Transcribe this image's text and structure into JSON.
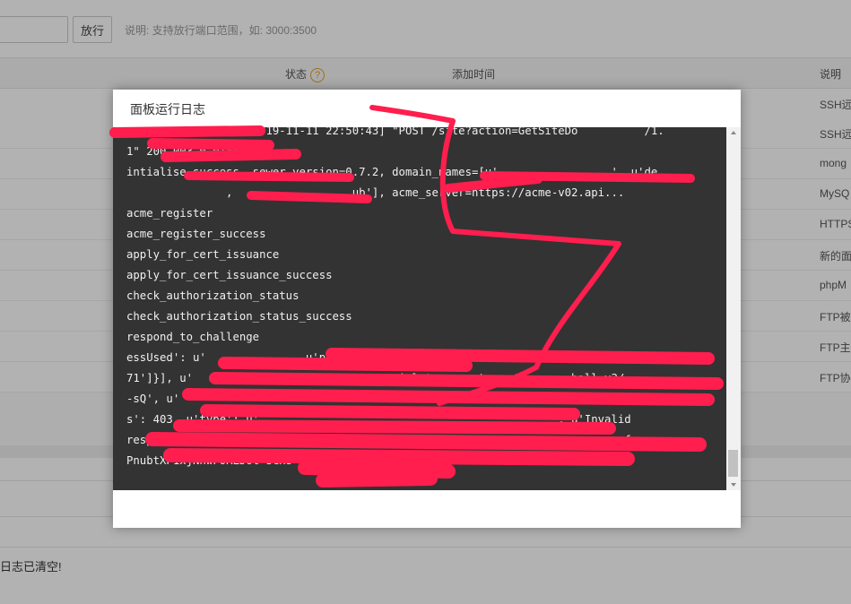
{
  "toolbar": {
    "port_input_value": "",
    "release_button": "放行",
    "hint": "说明: 支持放行端口范围，如: 3000:3500"
  },
  "table": {
    "headers": {
      "status": "状态",
      "status_help": "?",
      "added_time": "添加时间",
      "description": "说明"
    },
    "rows": [
      {
        "description": "SSH远"
      },
      {
        "description": "SSH远"
      },
      {
        "description": "mong"
      },
      {
        "description": "MySQ"
      },
      {
        "description": "HTTPS"
      },
      {
        "description": "新的面"
      },
      {
        "description": "phpM"
      },
      {
        "description": "FTP被"
      },
      {
        "description": "FTP主"
      },
      {
        "description": "FTP协"
      }
    ]
  },
  "footer_message": "日志已清空!",
  "modal": {
    "title": "面板运行日志",
    "log_lines": [
      "3                  2019-11-11 22:50:43] \"POST /site?action=GetSiteDo          /1.",
      "1\" 200 003 0.014661",
      "intialise_success, sewer_version=0.7.2, domain_names=[u'                 ', u'de",
      "               ,                  ub'], acme_server=https://acme-v02.api...",
      "acme_register",
      "acme_register_success",
      "apply_for_cert_issuance",
      "apply_for_cert_issuance_success",
      "check_authorization_status",
      "check_authorization_status_success",
      "respond_to_challenge",
      "essUsed': u'             , u'port':  u'443', u'addressesResolved': [u'            ",
      "71']}], u'    u'            //acme-v02.api.letsencrypt.org/        hall-v3/             ",
      "-sQ', u'                                                   , u'error': {u'statu",
      "s': 403, u'type': u'                                            ': u'Invalid",
      "respo       om                                                            ef",
      "PnubtXP1xjNnwFORLJOt-sCxs \\n"
    ]
  }
}
